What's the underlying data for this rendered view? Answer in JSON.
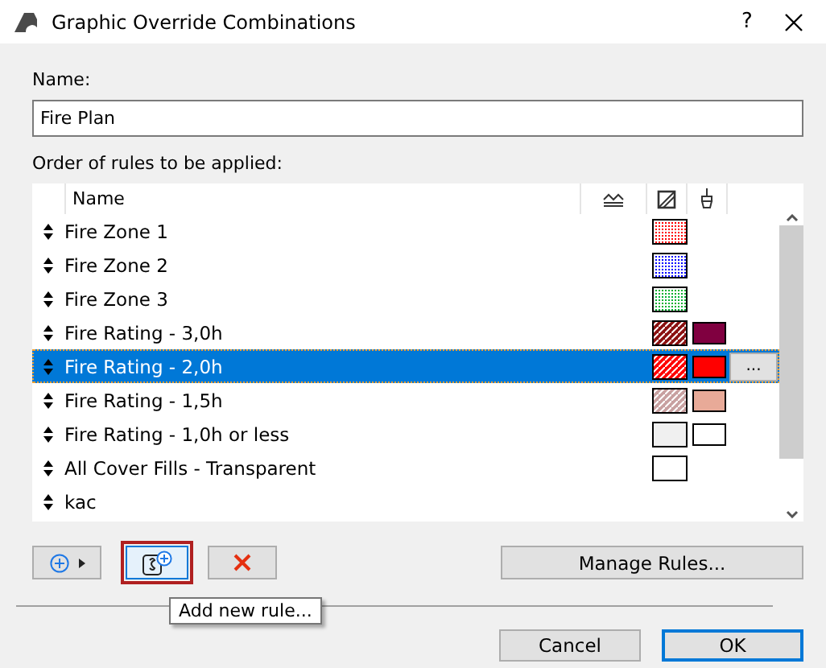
{
  "window": {
    "title": "Graphic Override Combinations",
    "help": "?"
  },
  "name_field": {
    "label": "Name:",
    "value": "Fire Plan"
  },
  "rules": {
    "label": "Order of rules to be applied:",
    "name_column": "Name",
    "rows": [
      {
        "name": "Fire Zone 1",
        "selected": false,
        "fill": {
          "kind": "dots",
          "color": "#ff0000"
        }
      },
      {
        "name": "Fire Zone 2",
        "selected": false,
        "fill": {
          "kind": "dots",
          "color": "#0000ff"
        }
      },
      {
        "name": "Fire Zone 3",
        "selected": false,
        "fill": {
          "kind": "dots",
          "color": "#00b030"
        }
      },
      {
        "name": "Fire Rating - 3,0h",
        "selected": false,
        "fill": {
          "kind": "hatch",
          "color": "#8b1010"
        },
        "background": {
          "color": "#800040"
        }
      },
      {
        "name": "Fire Rating - 2,0h",
        "selected": true,
        "fill": {
          "kind": "hatch",
          "color": "#ff0000"
        },
        "background": {
          "color": "#ff0000"
        },
        "more": "..."
      },
      {
        "name": "Fire Rating - 1,5h",
        "selected": false,
        "fill": {
          "kind": "hatch",
          "color": "#c8a0a0"
        },
        "background": {
          "color": "#e8aa98"
        }
      },
      {
        "name": "Fire Rating - 1,0h or less",
        "selected": false,
        "fill": {
          "kind": "plain",
          "color": "#f0f0f0"
        },
        "background": {
          "color": "#ffffff"
        }
      },
      {
        "name": "All Cover Fills - Transparent",
        "selected": false,
        "fill": {
          "kind": "plain",
          "color": "#ffffff"
        }
      },
      {
        "name": "kac",
        "selected": false
      }
    ]
  },
  "new_rule_button": {
    "highlighted": true
  },
  "tooltip": "Add new rule...",
  "manage_button": "Manage Rules...",
  "buttons": [
    {
      "label": "Cancel",
      "default": false
    },
    {
      "label": "OK",
      "default": true
    }
  ]
}
